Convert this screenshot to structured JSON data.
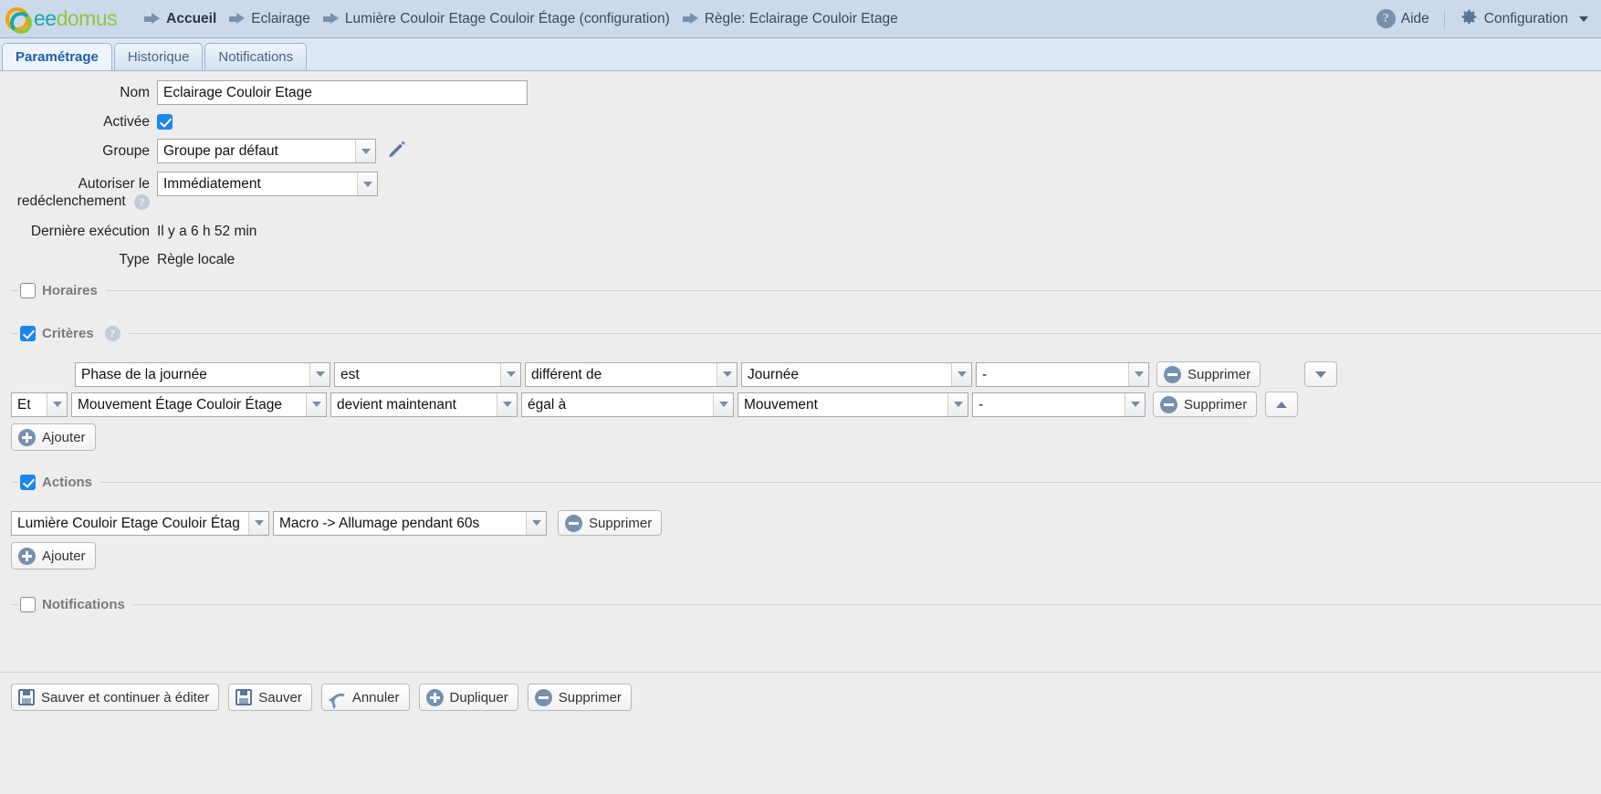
{
  "brand": {
    "name_part1": "ee",
    "name_part2": "domus"
  },
  "breadcrumbs": [
    {
      "label": "Accueil",
      "bold": true
    },
    {
      "label": "Eclairage",
      "bold": false
    },
    {
      "label": "Lumière Couloir Etage Couloir Étage (configuration)",
      "bold": false
    },
    {
      "label": "Règle: Eclairage Couloir Etage",
      "bold": false
    }
  ],
  "topright": {
    "help_label": "Aide",
    "help_icon": "question-circle-icon",
    "config_label": "Configuration",
    "config_icon": "gear-icon",
    "caret_icon": "chevron-down-icon"
  },
  "tabs": [
    {
      "label": "Paramétrage",
      "active": true
    },
    {
      "label": "Historique",
      "active": false
    },
    {
      "label": "Notifications",
      "active": false
    }
  ],
  "form": {
    "nom": {
      "label": "Nom",
      "value": "Eclairage Couloir Etage",
      "placeholder": ""
    },
    "activee": {
      "label": "Activée",
      "checked": true
    },
    "groupe": {
      "label": "Groupe",
      "value": "Groupe par défaut",
      "edit_icon": "pencil-icon"
    },
    "redeclenchement": {
      "label_line1": "Autoriser le",
      "label_line2": "redéclenchement",
      "value": "Immédiatement",
      "help_icon": "question-circle-icon"
    },
    "derniere_execution": {
      "label": "Dernière exécution",
      "value": "Il y a 6 h 52 min"
    },
    "type": {
      "label": "Type",
      "value": "Règle locale"
    }
  },
  "sections": {
    "horaires": {
      "title": "Horaires",
      "checked": false
    },
    "criteres": {
      "title": "Critères",
      "checked": true,
      "help_icon": "question-circle-icon"
    },
    "actions": {
      "title": "Actions",
      "checked": true
    },
    "notifications": {
      "title": "Notifications",
      "checked": false
    }
  },
  "criteres": {
    "rows": [
      {
        "conjunction": "",
        "subject": "Phase de la journée",
        "verb": "est",
        "operator": "différent de",
        "value": "Journée",
        "extra": "-",
        "delete_label": "Supprimer",
        "move_icon": "chevron-down-icon"
      },
      {
        "conjunction": "Et",
        "subject": "Mouvement Étage Couloir Étage",
        "verb": "devient maintenant",
        "operator": "égal à",
        "value": "Mouvement",
        "extra": "-",
        "delete_label": "Supprimer",
        "move_icon": "chevron-up-icon"
      }
    ],
    "add_label": "Ajouter"
  },
  "actions": {
    "rows": [
      {
        "target": "Lumière Couloir Etage Couloir Étag",
        "command": "Macro -> Allumage pendant 60s",
        "delete_label": "Supprimer"
      }
    ],
    "add_label": "Ajouter"
  },
  "bottom_toolbar": [
    {
      "label": "Sauver et continuer à éditer",
      "icon": "save-icon"
    },
    {
      "label": "Sauver",
      "icon": "save-icon"
    },
    {
      "label": "Annuler",
      "icon": "undo-icon"
    },
    {
      "label": "Dupliquer",
      "icon": "plus-circle-icon"
    },
    {
      "label": "Supprimer",
      "icon": "minus-circle-icon"
    }
  ],
  "colors": {
    "topbar_bg": "#ccd9ea",
    "tabbar_bg": "#dbe7f4",
    "content_bg": "#ededed",
    "accent_blue": "#1a87f0",
    "icon_blue": "#7890b0",
    "active_tab_text": "#1d5fa8"
  }
}
